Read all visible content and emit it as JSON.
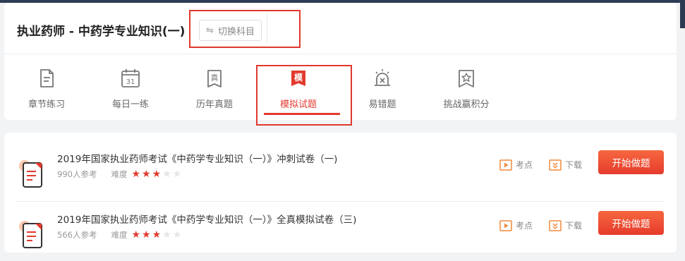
{
  "header": {
    "title": "执业药师 - 中药学专业知识(一)",
    "switch_label": "切换科目"
  },
  "tabs": [
    {
      "label": "章节练习",
      "icon": "doc-icon",
      "active": false
    },
    {
      "label": "每日一练",
      "icon": "calendar-icon",
      "icon_text": "31",
      "active": false
    },
    {
      "label": "历年真题",
      "icon": "zhen-badge-icon",
      "icon_text": "真",
      "active": false
    },
    {
      "label": "模拟试题",
      "icon": "mo-badge-icon",
      "icon_text": "模",
      "active": true
    },
    {
      "label": "易错题",
      "icon": "warning-light-icon",
      "active": false
    },
    {
      "label": "挑战赢积分",
      "icon": "star-flag-icon",
      "active": false
    }
  ],
  "papers": [
    {
      "title": "2019年国家执业药师考试《中药学专业知识（一）》冲刺试卷（一)",
      "participants": "990人参考",
      "difficulty_label": "难度",
      "difficulty": 3,
      "difficulty_max": 5,
      "kaodian": "考点",
      "download": "下载",
      "start": "开始做题"
    },
    {
      "title": "2019年国家执业药师考试《中药学专业知识（一）》全真模拟试卷（三)",
      "participants": "566人参考",
      "difficulty_label": "难度",
      "difficulty": 3,
      "difficulty_max": 5,
      "kaodian": "考点",
      "download": "下载",
      "start": "开始做题"
    }
  ],
  "colors": {
    "accent": "#e23a2e",
    "button_gradient_top": "#f6673f",
    "action_icon": "#f08a3c"
  }
}
